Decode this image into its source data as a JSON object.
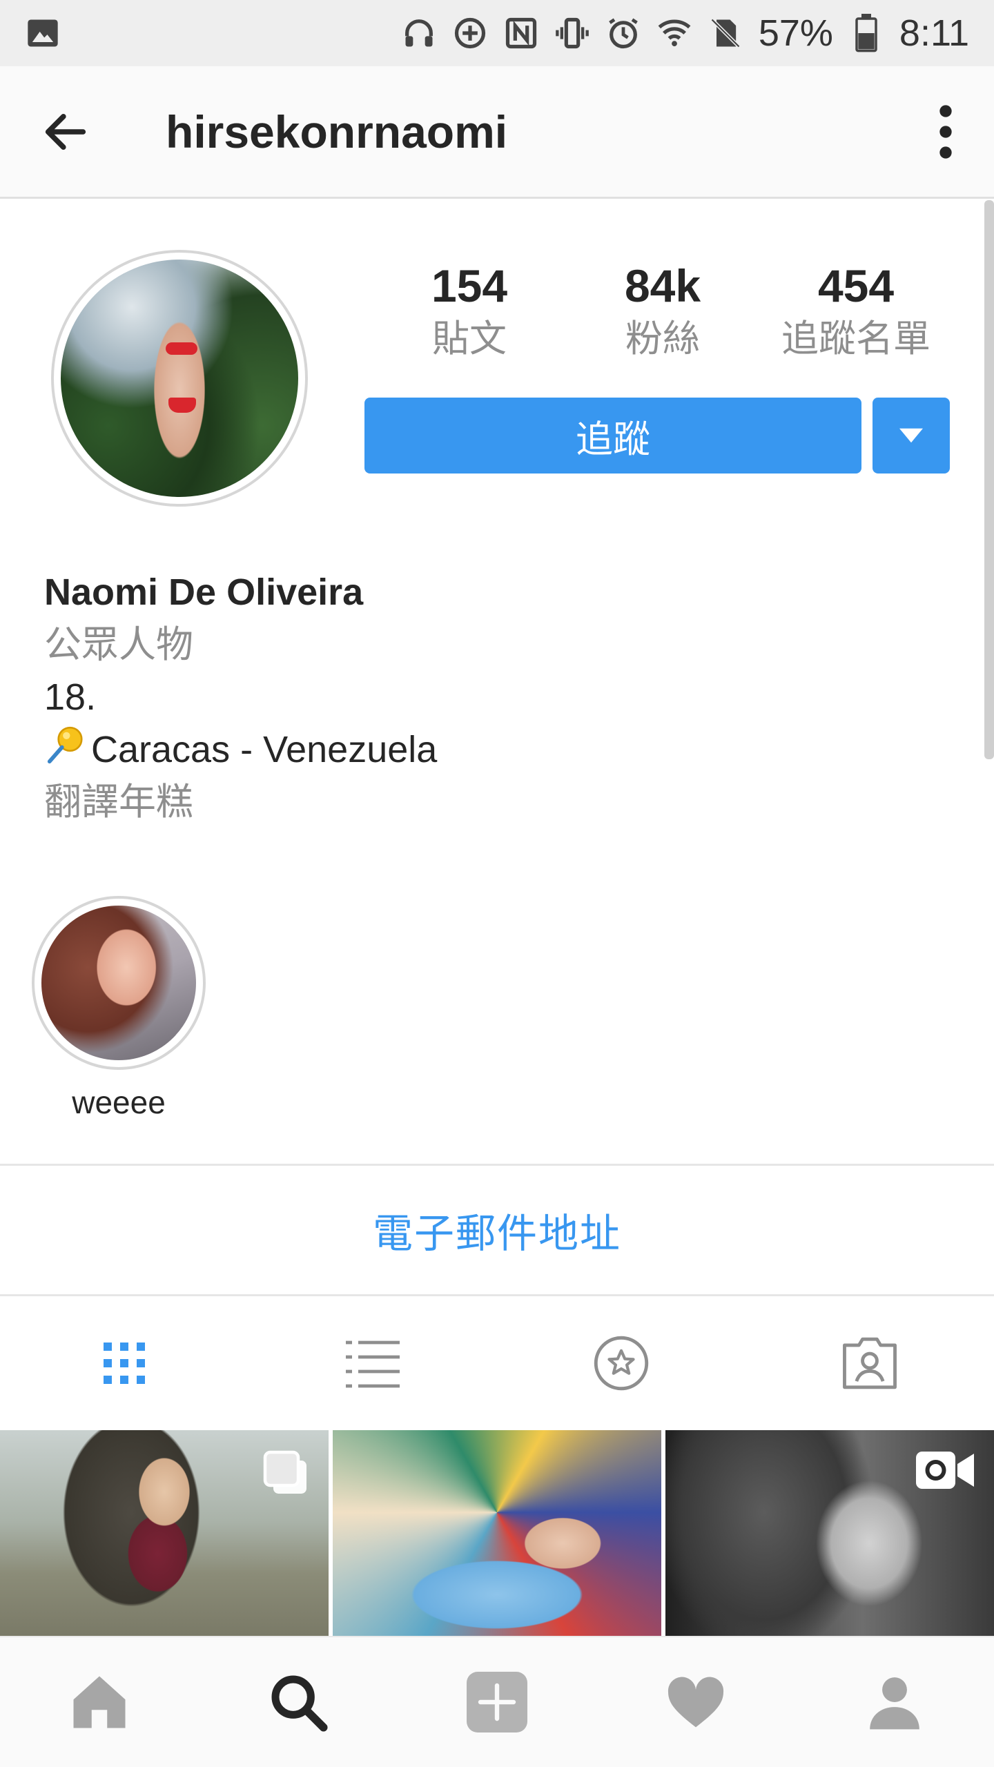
{
  "status_bar": {
    "battery_percent": "57%",
    "time": "8:11"
  },
  "header": {
    "username": "hirsekonrnaomi"
  },
  "profile": {
    "stats": [
      {
        "value": "154",
        "label": "貼文"
      },
      {
        "value": "84k",
        "label": "粉絲"
      },
      {
        "value": "454",
        "label": "追蹤名單"
      }
    ],
    "follow_label": "追蹤"
  },
  "bio": {
    "name": "Naomi De Oliveira",
    "category": "公眾人物",
    "line1": "18.",
    "location": "Caracas - Venezuela",
    "translate_label": "翻譯年糕"
  },
  "highlights": [
    {
      "label": "weeee"
    }
  ],
  "contact": {
    "email_label": "電子郵件地址"
  },
  "colors": {
    "accent": "#3897f0",
    "muted": "#8e8e8e",
    "text": "#262626"
  }
}
